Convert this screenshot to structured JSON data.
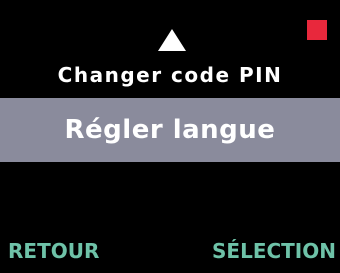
{
  "colors": {
    "background": "#000000",
    "text": "#ffffff",
    "highlight": "#8a8b9c",
    "softkey": "#6ec2a8",
    "status_indicator": "#e8283c"
  },
  "icons": {
    "scroll_up": "up-triangle-icon",
    "status": "red-square-indicator"
  },
  "menu": {
    "previous_item": "Changer code PIN",
    "selected_item": "Régler langue"
  },
  "softkeys": {
    "left": "RETOUR",
    "right": "SÉLECTION"
  }
}
